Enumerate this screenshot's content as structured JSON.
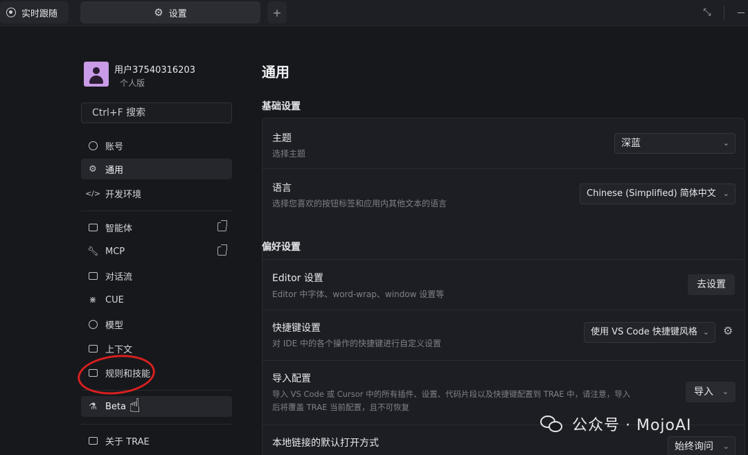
{
  "tabs": {
    "follow_label": "实时跟随",
    "settings_label": "设置",
    "add_label": "+"
  },
  "sidebar": {
    "user_name": "用户37540316203",
    "user_plan": "个人版",
    "search_placeholder": "Ctrl+F 搜索",
    "items": [
      {
        "label": "账号",
        "icon": "account-icon"
      },
      {
        "label": "通用",
        "icon": "gear-icon",
        "active": true
      },
      {
        "label": "开发环境",
        "icon": "code-icon"
      },
      {
        "label": "智能体",
        "icon": "agent-icon",
        "external": true
      },
      {
        "label": "MCP",
        "icon": "wrench-icon",
        "external": true
      },
      {
        "label": "对话流",
        "icon": "chat-icon"
      },
      {
        "label": "CUE",
        "icon": "cue-icon"
      },
      {
        "label": "模型",
        "icon": "model-icon"
      },
      {
        "label": "上下文",
        "icon": "folder-icon"
      },
      {
        "label": "规则和技能",
        "icon": "rules-icon"
      },
      {
        "label": "Beta",
        "icon": "flask-icon"
      },
      {
        "label": "关于 TRAE",
        "icon": "info-icon"
      }
    ]
  },
  "main": {
    "title": "通用",
    "basic": {
      "section_title": "基础设置",
      "theme_label": "主题",
      "theme_desc": "选择主题",
      "theme_value": "深蓝",
      "lang_label": "语言",
      "lang_desc": "选择您喜欢的按钮标签和应用内其他文本的语言",
      "lang_value": "Chinese (Simplified) 简体中文"
    },
    "prefs": {
      "section_title": "偏好设置",
      "editor_label": "Editor 设置",
      "editor_desc": "Editor 中字体、word-wrap、window 设置等",
      "editor_button": "去设置",
      "shortcut_label": "快捷键设置",
      "shortcut_desc": "对 IDE 中的各个操作的快捷键进行自定义设置",
      "shortcut_value": "使用 VS Code 快捷键风格",
      "import_label": "导入配置",
      "import_desc_1": "导入 VS Code 或 Cursor 中的所有插件、设置、代码片段以及快捷键配置到 TRAE 中，请注意，导入",
      "import_desc_2": "后将覆盖 TRAE 当前配置，且不可恢复",
      "import_button": "导入",
      "link_label": "本地链接的默认打开方式",
      "link_value": "始终询问"
    }
  },
  "watermark": {
    "text": "公众号 · MojoAI"
  }
}
